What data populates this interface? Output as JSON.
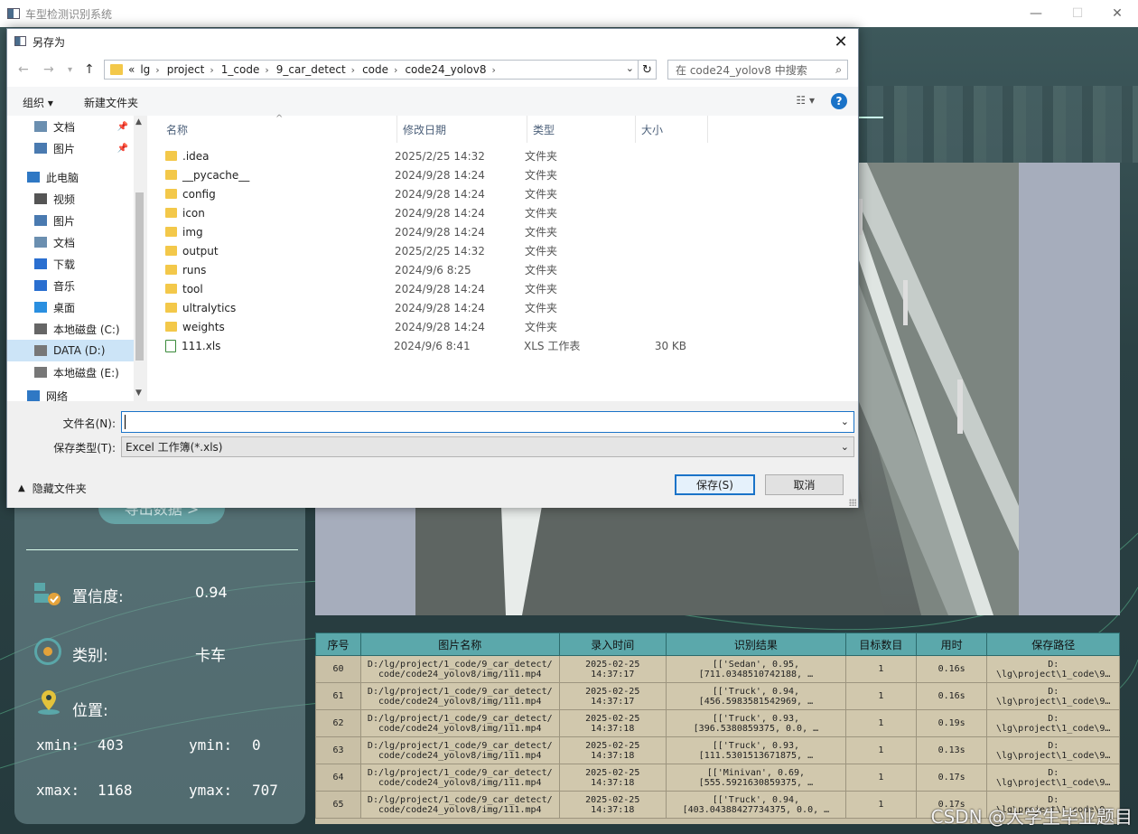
{
  "app": {
    "title": "车型检测识别系统",
    "export_label": "导出数据 >",
    "confidence_label": "置信度:",
    "confidence_value": "0.94",
    "class_label": "类别:",
    "class_value": "卡车",
    "position_label": "位置:",
    "xmin_label": "xmin:",
    "xmin_value": "403",
    "ymin_label": "ymin:",
    "ymin_value": "0",
    "xmax_label": "xmax:",
    "xmax_value": "1168",
    "ymax_label": "ymax:",
    "ymax_value": "707",
    "watermark": "CSDN @大学生毕业题目"
  },
  "table": {
    "headers": [
      "序号",
      "图片名称",
      "录入时间",
      "识别结果",
      "目标数目",
      "用时",
      "保存路径"
    ],
    "rows": [
      {
        "no": "60",
        "name1": "D:/lg/project/1_code/9_car_detect/",
        "name2": "code/code24_yolov8/img/111.mp4",
        "t1": "2025-02-25",
        "t2": "14:37:17",
        "r1": "[['Sedan', 0.95,",
        "r2": "[711.0348510742188, …",
        "count": "1",
        "time": "0.16s",
        "p1": "D:",
        "p2": "\\lg\\project\\1_code\\9…"
      },
      {
        "no": "61",
        "name1": "D:/lg/project/1_code/9_car_detect/",
        "name2": "code/code24_yolov8/img/111.mp4",
        "t1": "2025-02-25",
        "t2": "14:37:17",
        "r1": "[['Truck', 0.94,",
        "r2": "[456.5983581542969, …",
        "count": "1",
        "time": "0.16s",
        "p1": "D:",
        "p2": "\\lg\\project\\1_code\\9…"
      },
      {
        "no": "62",
        "name1": "D:/lg/project/1_code/9_car_detect/",
        "name2": "code/code24_yolov8/img/111.mp4",
        "t1": "2025-02-25",
        "t2": "14:37:18",
        "r1": "[['Truck', 0.93,",
        "r2": "[396.5380859375, 0.0, …",
        "count": "1",
        "time": "0.19s",
        "p1": "D:",
        "p2": "\\lg\\project\\1_code\\9…"
      },
      {
        "no": "63",
        "name1": "D:/lg/project/1_code/9_car_detect/",
        "name2": "code/code24_yolov8/img/111.mp4",
        "t1": "2025-02-25",
        "t2": "14:37:18",
        "r1": "[['Truck', 0.93,",
        "r2": "[111.5301513671875, …",
        "count": "1",
        "time": "0.13s",
        "p1": "D:",
        "p2": "\\lg\\project\\1_code\\9…"
      },
      {
        "no": "64",
        "name1": "D:/lg/project/1_code/9_car_detect/",
        "name2": "code/code24_yolov8/img/111.mp4",
        "t1": "2025-02-25",
        "t2": "14:37:18",
        "r1": "[['Minivan', 0.69,",
        "r2": "[555.5921630859375, …",
        "count": "1",
        "time": "0.17s",
        "p1": "D:",
        "p2": "\\lg\\project\\1_code\\9…"
      },
      {
        "no": "65",
        "name1": "D:/lg/project/1_code/9_car_detect/",
        "name2": "code/code24_yolov8/img/111.mp4",
        "t1": "2025-02-25",
        "t2": "14:37:18",
        "r1": "[['Truck', 0.94,",
        "r2": "[403.04388427734375, 0.0, …",
        "count": "1",
        "time": "0.17s",
        "p1": "D:",
        "p2": "\\lg\\project\\1_code\\9…"
      }
    ]
  },
  "dialog": {
    "title": "另存为",
    "breadcrumbs": [
      "«",
      "lg",
      "project",
      "1_code",
      "9_car_detect",
      "code",
      "code24_yolov8"
    ],
    "search_placeholder": "在 code24_yolov8 中搜索",
    "organize": "组织 ▾",
    "new_folder": "新建文件夹",
    "nav_items": [
      {
        "label": "文档",
        "pinned": true
      },
      {
        "label": "图片",
        "pinned": true
      },
      {
        "label": "此电脑",
        "pinned": false
      },
      {
        "label": "视频",
        "pinned": false
      },
      {
        "label": "图片",
        "pinned": false
      },
      {
        "label": "文档",
        "pinned": false
      },
      {
        "label": "下载",
        "pinned": false
      },
      {
        "label": "音乐",
        "pinned": false
      },
      {
        "label": "桌面",
        "pinned": false
      },
      {
        "label": "本地磁盘 (C:)",
        "pinned": false
      },
      {
        "label": "DATA (D:)",
        "pinned": false
      },
      {
        "label": "本地磁盘 (E:)",
        "pinned": false
      },
      {
        "label": "网络",
        "pinned": false
      }
    ],
    "columns": [
      "名称",
      "修改日期",
      "类型",
      "大小"
    ],
    "files": [
      {
        "name": ".idea",
        "date": "2025/2/25 14:32",
        "type": "文件夹",
        "size": ""
      },
      {
        "name": "__pycache__",
        "date": "2024/9/28 14:24",
        "type": "文件夹",
        "size": ""
      },
      {
        "name": "config",
        "date": "2024/9/28 14:24",
        "type": "文件夹",
        "size": ""
      },
      {
        "name": "icon",
        "date": "2024/9/28 14:24",
        "type": "文件夹",
        "size": ""
      },
      {
        "name": "img",
        "date": "2024/9/28 14:24",
        "type": "文件夹",
        "size": ""
      },
      {
        "name": "output",
        "date": "2025/2/25 14:32",
        "type": "文件夹",
        "size": ""
      },
      {
        "name": "runs",
        "date": "2024/9/6 8:25",
        "type": "文件夹",
        "size": ""
      },
      {
        "name": "tool",
        "date": "2024/9/28 14:24",
        "type": "文件夹",
        "size": ""
      },
      {
        "name": "ultralytics",
        "date": "2024/9/28 14:24",
        "type": "文件夹",
        "size": ""
      },
      {
        "name": "weights",
        "date": "2024/9/28 14:24",
        "type": "文件夹",
        "size": ""
      },
      {
        "name": "111.xls",
        "date": "2024/9/6 8:41",
        "type": "XLS 工作表",
        "size": "30 KB"
      }
    ],
    "filename_label": "文件名(N):",
    "filename_value": "",
    "filetype_label": "保存类型(T):",
    "filetype_value": "Excel 工作簿(*.xls)",
    "hide_folders": "隐藏文件夹",
    "save": "保存(S)",
    "cancel": "取消"
  }
}
